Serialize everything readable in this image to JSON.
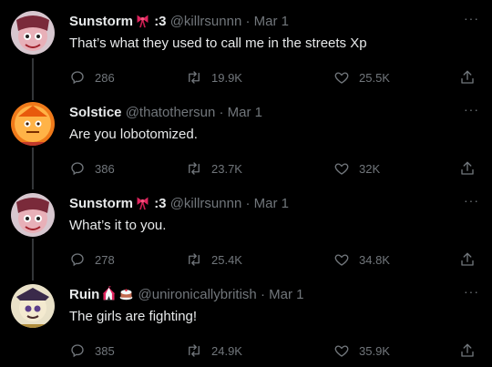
{
  "tweets": [
    {
      "name": "Sunstorm",
      "name_suffix": ":3",
      "handle": "@killrsunnn",
      "date": "Mar 1",
      "text": "That’s what they used to call me in the streets Xp",
      "replies": "286",
      "retweets": "19.9K",
      "likes": "25.5K",
      "emoji": [
        "ribbon-icon"
      ]
    },
    {
      "name": "Solstice",
      "handle": "@thatothersun",
      "date": "Mar 1",
      "text": "Are you lobotomized.",
      "replies": "386",
      "retweets": "23.7K",
      "likes": "32K"
    },
    {
      "name": "Sunstorm",
      "name_suffix": ":3",
      "handle": "@killrsunnn",
      "date": "Mar 1",
      "text": "What’s it to you.",
      "replies": "278",
      "retweets": "25.4K",
      "likes": "34.8K",
      "emoji": [
        "ribbon-icon"
      ]
    },
    {
      "name": "Ruin",
      "handle": "@unironicallybritish",
      "date": "Mar 1",
      "text": "The girls are fighting!",
      "replies": "385",
      "retweets": "24.9K",
      "likes": "35.9K",
      "emoji": [
        "circus-tent-icon",
        "cake-icon"
      ]
    }
  ],
  "separator": "·",
  "more_label": "···",
  "colors": {
    "background": "#000000",
    "text_primary": "#e7e9ea",
    "text_secondary": "#71767b",
    "thread_line": "#333639"
  },
  "icons": [
    "reply-icon",
    "retweet-icon",
    "like-icon",
    "share-icon",
    "more-icon"
  ]
}
